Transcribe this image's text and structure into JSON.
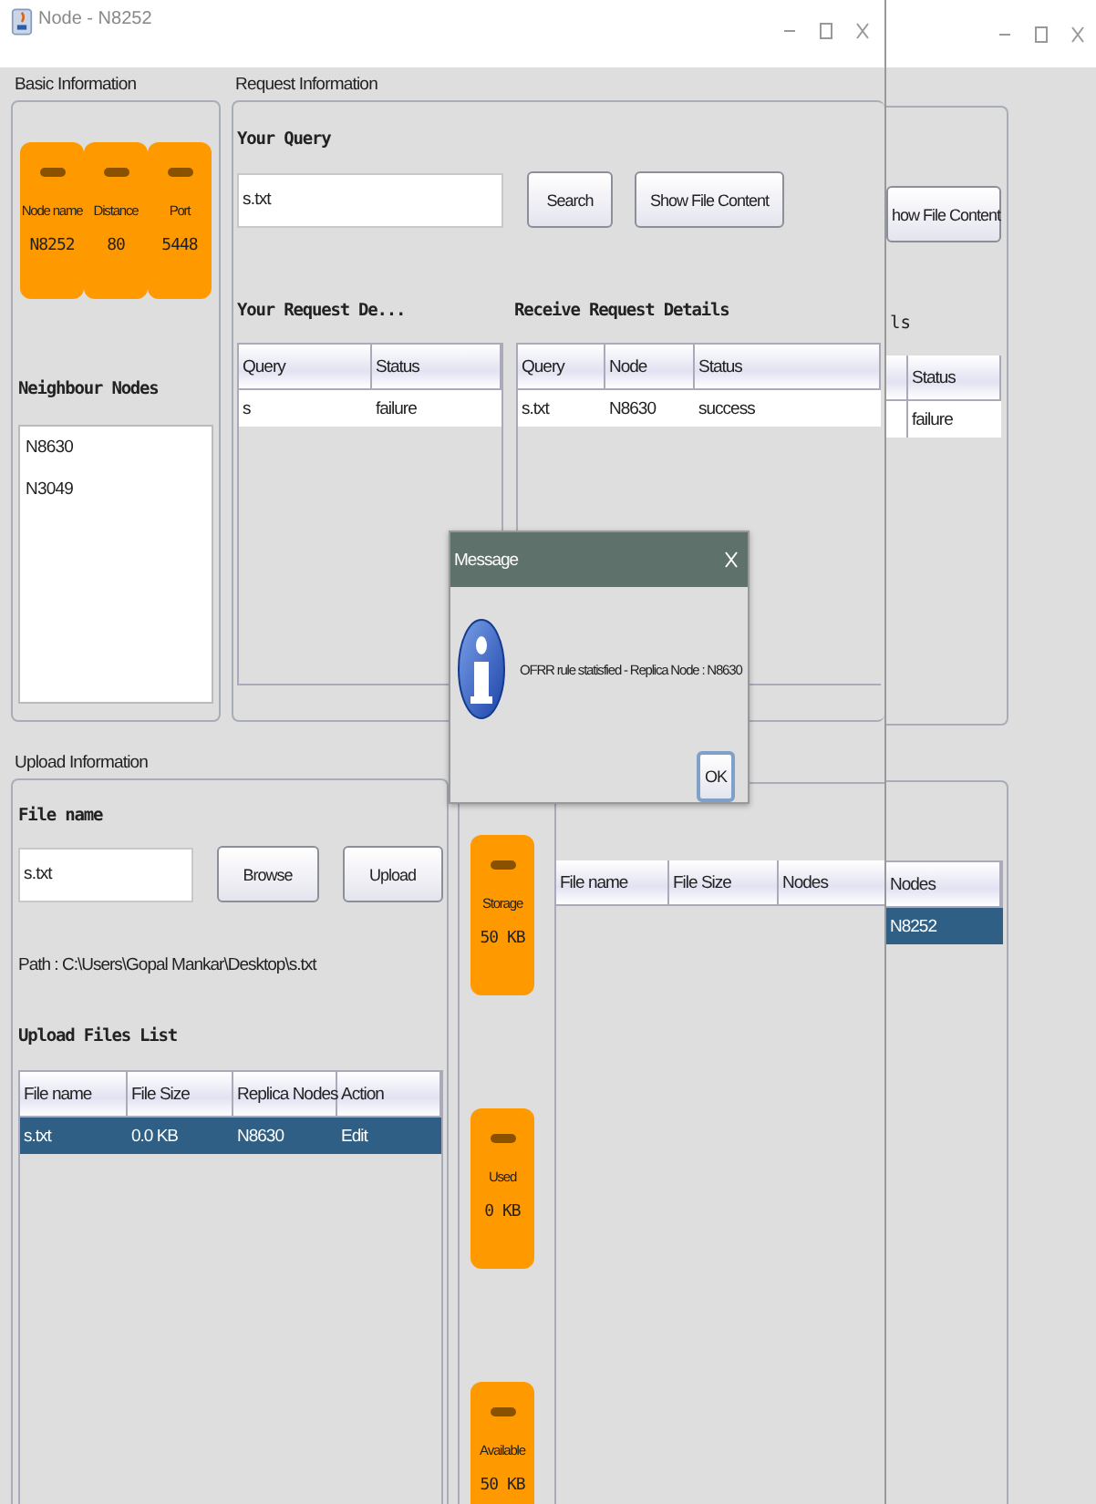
{
  "window": {
    "title": "Node - N8252"
  },
  "basic_information": {
    "title": "Basic Information",
    "cards": [
      {
        "label": "Node name",
        "value": "N8252"
      },
      {
        "label": "Distance",
        "value": "80"
      },
      {
        "label": "Port",
        "value": "5448"
      }
    ],
    "neighbour_title": "Neighbour Nodes",
    "neighbours": [
      "N8630",
      "N3049"
    ]
  },
  "request_information": {
    "title": "Request Information",
    "query_label": "Your Query",
    "query_value": "s.txt",
    "buttons": [
      "Search",
      "Show File Content"
    ],
    "your_requests": {
      "title": "Your Request De...",
      "columns": [
        "Query",
        "Status"
      ],
      "rows": [
        [
          "s",
          "failure"
        ]
      ]
    },
    "received_requests": {
      "title": "Receive Request Details",
      "columns": [
        "Query",
        "Node",
        "Status"
      ],
      "rows": [
        [
          "s.txt",
          "N8630",
          "success"
        ]
      ]
    }
  },
  "upload_information": {
    "title": "Upload Information",
    "file_label": "File name",
    "file_value": "s.txt",
    "buttons": [
      "Browse",
      "Upload"
    ],
    "path": "Path : C:\\Users\\Gopal Mankar\\Desktop\\s.txt",
    "list_title": "Upload Files List",
    "columns": [
      "File name",
      "File Size",
      "Replica Nodes",
      "Action"
    ],
    "rows": [
      {
        "cells": [
          "s.txt",
          "0.0 KB",
          "N8630",
          "Edit"
        ],
        "selected": true
      }
    ]
  },
  "storage": {
    "cards": [
      {
        "label": "Storage",
        "value": "50 KB"
      },
      {
        "label": "Used",
        "value": "0 KB"
      },
      {
        "label": "Available",
        "value": "50 KB"
      }
    ],
    "columns": [
      "File name",
      "File Size",
      "Nodes"
    ]
  },
  "dialog": {
    "title": "Message",
    "message": "OFRR rule statisfied - Replica Node : N8630",
    "button": "OK"
  },
  "background_window": {
    "button": "how File Content",
    "heading": "ls",
    "requests_column": "Status",
    "requests_rows": [
      "failure"
    ],
    "nodes_column": "Nodes",
    "nodes_rows": [
      {
        "text": "N8252",
        "selected": true
      }
    ]
  }
}
